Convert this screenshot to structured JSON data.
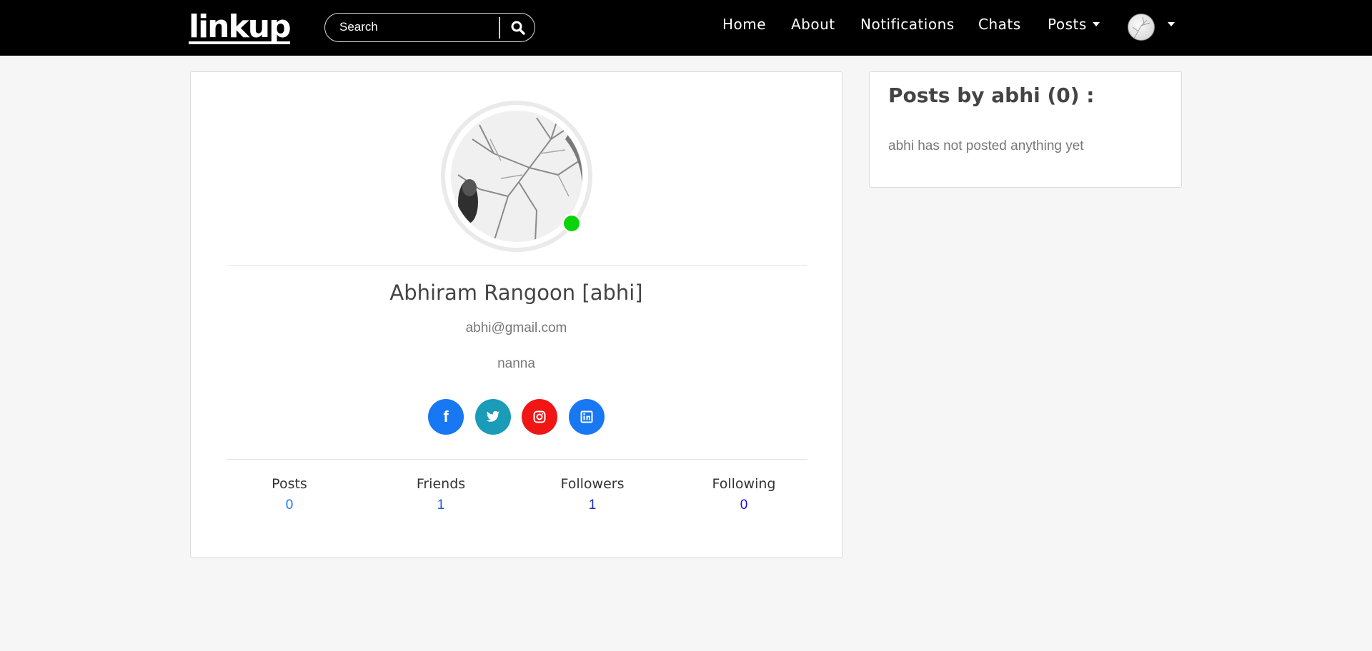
{
  "nav": {
    "logo": "linkup",
    "search_placeholder": "Search",
    "links": [
      {
        "label": "Home"
      },
      {
        "label": "About"
      },
      {
        "label": "Notifications"
      },
      {
        "label": "Chats"
      },
      {
        "label": "Posts"
      }
    ],
    "search_icon": "search-icon",
    "caret_icon": "chevron-down-icon"
  },
  "profile": {
    "name": "Abhiram Rangoon [abhi]",
    "email": "abhi@gmail.com",
    "bio": "nanna",
    "online": true,
    "online_color": "#0bd30b",
    "social": [
      {
        "icon": "facebook-icon",
        "glyph": "f",
        "color": "#1877f2"
      },
      {
        "icon": "twitter-icon",
        "glyph": "",
        "color": "#1a9bb8"
      },
      {
        "icon": "instagram-icon",
        "glyph": "",
        "color": "#f01616"
      },
      {
        "icon": "linkedin-icon",
        "glyph": "in",
        "color": "#1877f2"
      }
    ],
    "stats": [
      {
        "label": "Posts",
        "value": "0",
        "color": "#1877f2"
      },
      {
        "label": "Friends",
        "value": "1",
        "color": "#1a5ad8"
      },
      {
        "label": "Followers",
        "value": "1",
        "color": "#1a2fc0"
      },
      {
        "label": "Following",
        "value": "0",
        "color": "#1a10d0"
      }
    ]
  },
  "posts_panel": {
    "title": "Posts by abhi (0) :",
    "empty_text": "abhi has not posted anything yet"
  }
}
